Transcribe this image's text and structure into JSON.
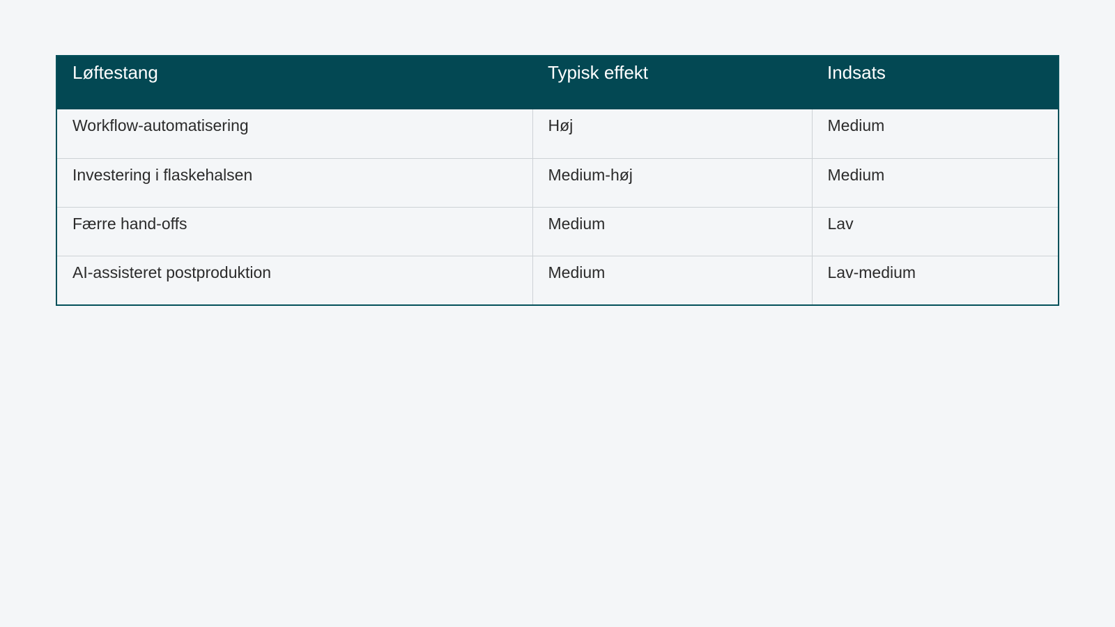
{
  "table": {
    "headers": [
      "Løftestang",
      "Typisk effekt",
      "Indsats"
    ],
    "rows": [
      [
        "Workflow-automatisering",
        "Høj",
        "Medium"
      ],
      [
        "Investering i flaskehalsen",
        "Medium-høj",
        "Medium"
      ],
      [
        "Færre hand-offs",
        "Medium",
        "Lav"
      ],
      [
        "AI-assisteret postproduktion",
        "Medium",
        "Lav-medium"
      ]
    ]
  },
  "colors": {
    "header_bg": "#034853",
    "page_bg": "#f4f6f8",
    "text": "#2b2b2b"
  }
}
